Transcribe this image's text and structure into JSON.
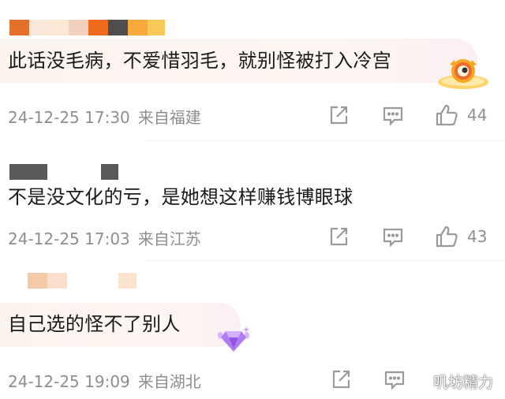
{
  "comments": [
    {
      "name_tiles": [
        "#e4712b",
        "#f9e7d9",
        "#fbe8d4",
        "#f1d1bd",
        "#ef6b1c",
        "#4e4e4e",
        "#f7a93b",
        "#f8c858"
      ],
      "text": "此话没毛病，不爱惜羽毛，就别怪被打入冷宫",
      "time": "24-12-25 17:30",
      "location": "来自福建",
      "likes": "44",
      "badge": "orange-mascot-emoji"
    },
    {
      "name_tiles": [
        "#5a5a5a",
        "#5a5a5a"
      ],
      "text": "不是没文化的亏，是她想这样赚钱博眼球",
      "time": "24-12-25 17:03",
      "location": "来自江苏",
      "likes": "43"
    },
    {
      "name_tiles": [
        "#f4c9a8",
        "#f9dfcc",
        "#f9e3cf"
      ],
      "text": "自己选的怪不了别人",
      "time": "24-12-25 19:09",
      "location": "来自湖北",
      "likes": "",
      "badge": "purple-gem-badge"
    }
  ],
  "actions": {
    "share_icon": "share-icon",
    "comment_icon": "comment-icon",
    "like_icon": "thumbs-up-icon"
  },
  "watermark": "叽坊精力",
  "colors": {
    "meta_text": "#8e8e8e",
    "icon": "#9a9a9a",
    "badge_orange": "#f6a623",
    "badge_purple": "#b07cf2"
  }
}
